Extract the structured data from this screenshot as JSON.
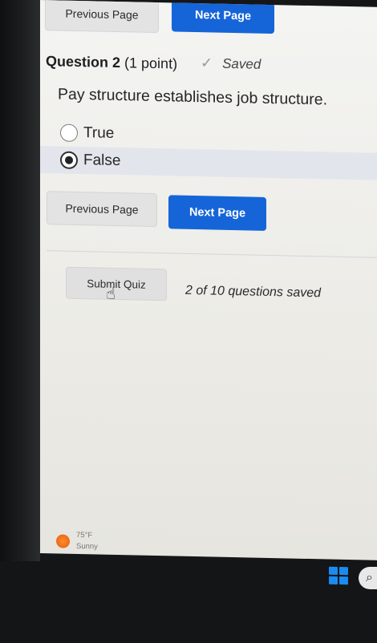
{
  "nav_top": {
    "previous_label": "Previous Page",
    "next_label": "Next Page"
  },
  "question": {
    "number_label": "Question 2",
    "points_label": "(1 point)",
    "saved_label": "Saved",
    "text": "Pay structure establishes job structure.",
    "options": [
      {
        "label": "True",
        "selected": false
      },
      {
        "label": "False",
        "selected": true
      }
    ]
  },
  "nav_bottom": {
    "previous_label": "Previous Page",
    "next_label": "Next Page"
  },
  "submit": {
    "label": "Submit Quiz",
    "status": "2 of 10 questions saved"
  },
  "weather": {
    "temp": "75°F",
    "condition": "Sunny"
  },
  "colors": {
    "accent": "#1565d8",
    "selected_row": "#e2e6ec",
    "weather_icon": "#e35c12",
    "windows_logo": "#1a8bf0"
  }
}
